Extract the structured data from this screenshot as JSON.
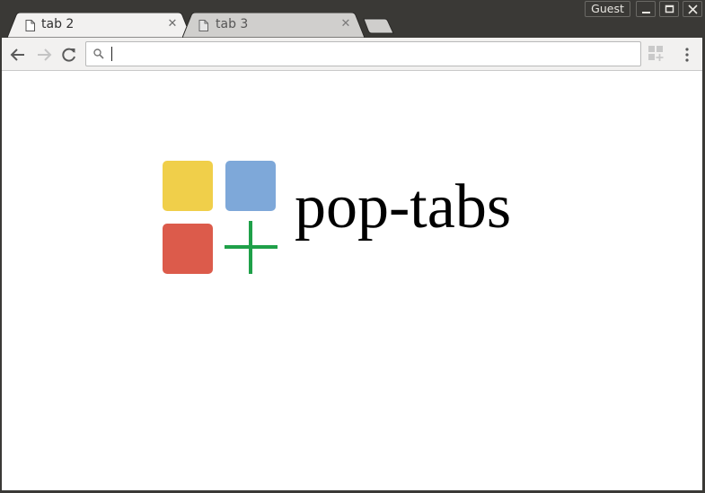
{
  "browser": {
    "tabs": [
      {
        "label": "tab 2",
        "active": true
      },
      {
        "label": "tab 3",
        "active": false
      }
    ],
    "profile_label": "Guest",
    "close_glyph": "✕"
  },
  "toolbar": {
    "omnibox_value": "",
    "omnibox_placeholder": ""
  },
  "page": {
    "brand_text": "pop-tabs",
    "logo_colors": {
      "yellow": "#f0cf4a",
      "blue": "#7ea8d9",
      "red": "#dc5b4b",
      "green": "#1fa049"
    }
  },
  "icons": {
    "back": "arrow-left-icon",
    "forward": "arrow-right-icon",
    "reload": "reload-icon",
    "search": "search-icon",
    "extensions": "apps-plus-icon",
    "menu": "kebab-menu-icon"
  }
}
